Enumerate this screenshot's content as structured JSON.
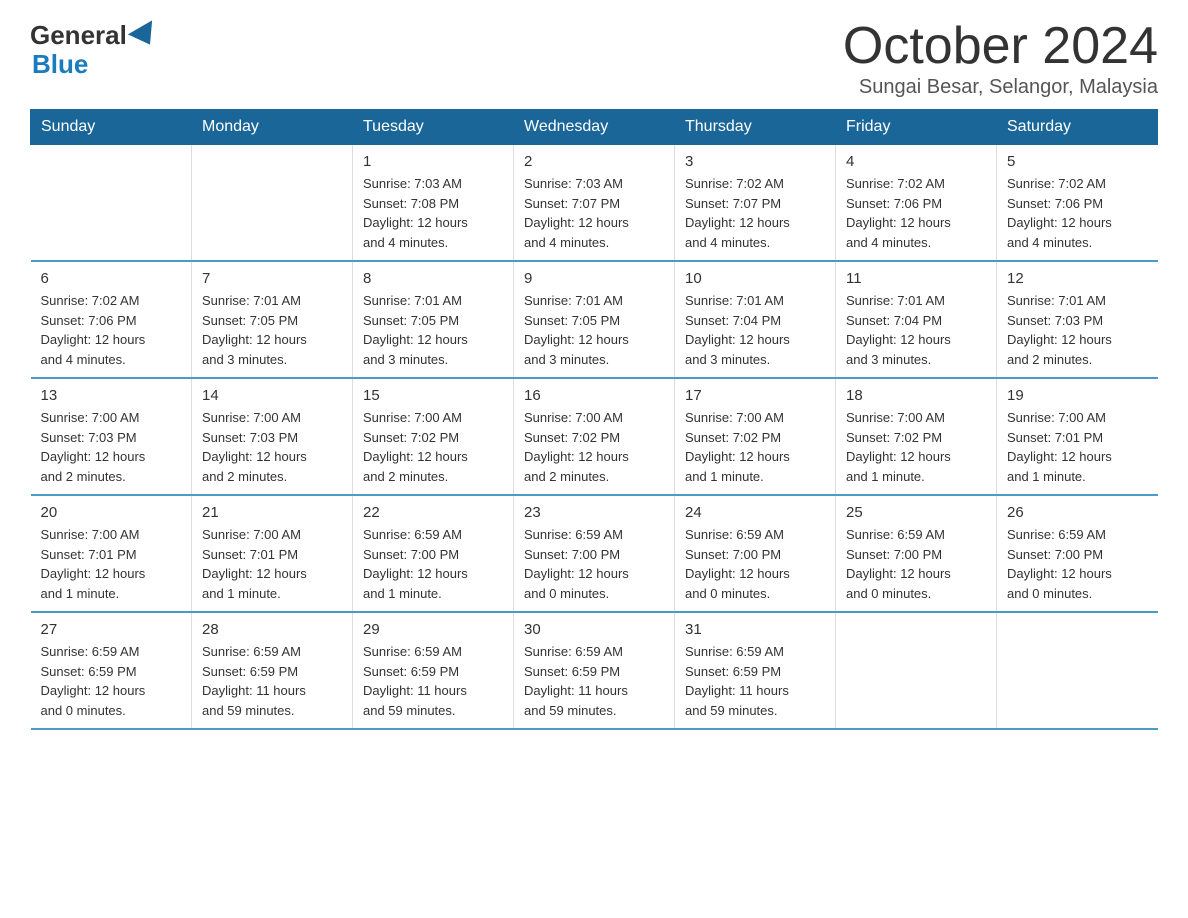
{
  "logo": {
    "general": "General",
    "blue": "Blue"
  },
  "header": {
    "month": "October 2024",
    "location": "Sungai Besar, Selangor, Malaysia"
  },
  "weekdays": [
    "Sunday",
    "Monday",
    "Tuesday",
    "Wednesday",
    "Thursday",
    "Friday",
    "Saturday"
  ],
  "weeks": [
    [
      {
        "day": "",
        "info": ""
      },
      {
        "day": "",
        "info": ""
      },
      {
        "day": "1",
        "info": "Sunrise: 7:03 AM\nSunset: 7:08 PM\nDaylight: 12 hours\nand 4 minutes."
      },
      {
        "day": "2",
        "info": "Sunrise: 7:03 AM\nSunset: 7:07 PM\nDaylight: 12 hours\nand 4 minutes."
      },
      {
        "day": "3",
        "info": "Sunrise: 7:02 AM\nSunset: 7:07 PM\nDaylight: 12 hours\nand 4 minutes."
      },
      {
        "day": "4",
        "info": "Sunrise: 7:02 AM\nSunset: 7:06 PM\nDaylight: 12 hours\nand 4 minutes."
      },
      {
        "day": "5",
        "info": "Sunrise: 7:02 AM\nSunset: 7:06 PM\nDaylight: 12 hours\nand 4 minutes."
      }
    ],
    [
      {
        "day": "6",
        "info": "Sunrise: 7:02 AM\nSunset: 7:06 PM\nDaylight: 12 hours\nand 4 minutes."
      },
      {
        "day": "7",
        "info": "Sunrise: 7:01 AM\nSunset: 7:05 PM\nDaylight: 12 hours\nand 3 minutes."
      },
      {
        "day": "8",
        "info": "Sunrise: 7:01 AM\nSunset: 7:05 PM\nDaylight: 12 hours\nand 3 minutes."
      },
      {
        "day": "9",
        "info": "Sunrise: 7:01 AM\nSunset: 7:05 PM\nDaylight: 12 hours\nand 3 minutes."
      },
      {
        "day": "10",
        "info": "Sunrise: 7:01 AM\nSunset: 7:04 PM\nDaylight: 12 hours\nand 3 minutes."
      },
      {
        "day": "11",
        "info": "Sunrise: 7:01 AM\nSunset: 7:04 PM\nDaylight: 12 hours\nand 3 minutes."
      },
      {
        "day": "12",
        "info": "Sunrise: 7:01 AM\nSunset: 7:03 PM\nDaylight: 12 hours\nand 2 minutes."
      }
    ],
    [
      {
        "day": "13",
        "info": "Sunrise: 7:00 AM\nSunset: 7:03 PM\nDaylight: 12 hours\nand 2 minutes."
      },
      {
        "day": "14",
        "info": "Sunrise: 7:00 AM\nSunset: 7:03 PM\nDaylight: 12 hours\nand 2 minutes."
      },
      {
        "day": "15",
        "info": "Sunrise: 7:00 AM\nSunset: 7:02 PM\nDaylight: 12 hours\nand 2 minutes."
      },
      {
        "day": "16",
        "info": "Sunrise: 7:00 AM\nSunset: 7:02 PM\nDaylight: 12 hours\nand 2 minutes."
      },
      {
        "day": "17",
        "info": "Sunrise: 7:00 AM\nSunset: 7:02 PM\nDaylight: 12 hours\nand 1 minute."
      },
      {
        "day": "18",
        "info": "Sunrise: 7:00 AM\nSunset: 7:02 PM\nDaylight: 12 hours\nand 1 minute."
      },
      {
        "day": "19",
        "info": "Sunrise: 7:00 AM\nSunset: 7:01 PM\nDaylight: 12 hours\nand 1 minute."
      }
    ],
    [
      {
        "day": "20",
        "info": "Sunrise: 7:00 AM\nSunset: 7:01 PM\nDaylight: 12 hours\nand 1 minute."
      },
      {
        "day": "21",
        "info": "Sunrise: 7:00 AM\nSunset: 7:01 PM\nDaylight: 12 hours\nand 1 minute."
      },
      {
        "day": "22",
        "info": "Sunrise: 6:59 AM\nSunset: 7:00 PM\nDaylight: 12 hours\nand 1 minute."
      },
      {
        "day": "23",
        "info": "Sunrise: 6:59 AM\nSunset: 7:00 PM\nDaylight: 12 hours\nand 0 minutes."
      },
      {
        "day": "24",
        "info": "Sunrise: 6:59 AM\nSunset: 7:00 PM\nDaylight: 12 hours\nand 0 minutes."
      },
      {
        "day": "25",
        "info": "Sunrise: 6:59 AM\nSunset: 7:00 PM\nDaylight: 12 hours\nand 0 minutes."
      },
      {
        "day": "26",
        "info": "Sunrise: 6:59 AM\nSunset: 7:00 PM\nDaylight: 12 hours\nand 0 minutes."
      }
    ],
    [
      {
        "day": "27",
        "info": "Sunrise: 6:59 AM\nSunset: 6:59 PM\nDaylight: 12 hours\nand 0 minutes."
      },
      {
        "day": "28",
        "info": "Sunrise: 6:59 AM\nSunset: 6:59 PM\nDaylight: 11 hours\nand 59 minutes."
      },
      {
        "day": "29",
        "info": "Sunrise: 6:59 AM\nSunset: 6:59 PM\nDaylight: 11 hours\nand 59 minutes."
      },
      {
        "day": "30",
        "info": "Sunrise: 6:59 AM\nSunset: 6:59 PM\nDaylight: 11 hours\nand 59 minutes."
      },
      {
        "day": "31",
        "info": "Sunrise: 6:59 AM\nSunset: 6:59 PM\nDaylight: 11 hours\nand 59 minutes."
      },
      {
        "day": "",
        "info": ""
      },
      {
        "day": "",
        "info": ""
      }
    ]
  ]
}
